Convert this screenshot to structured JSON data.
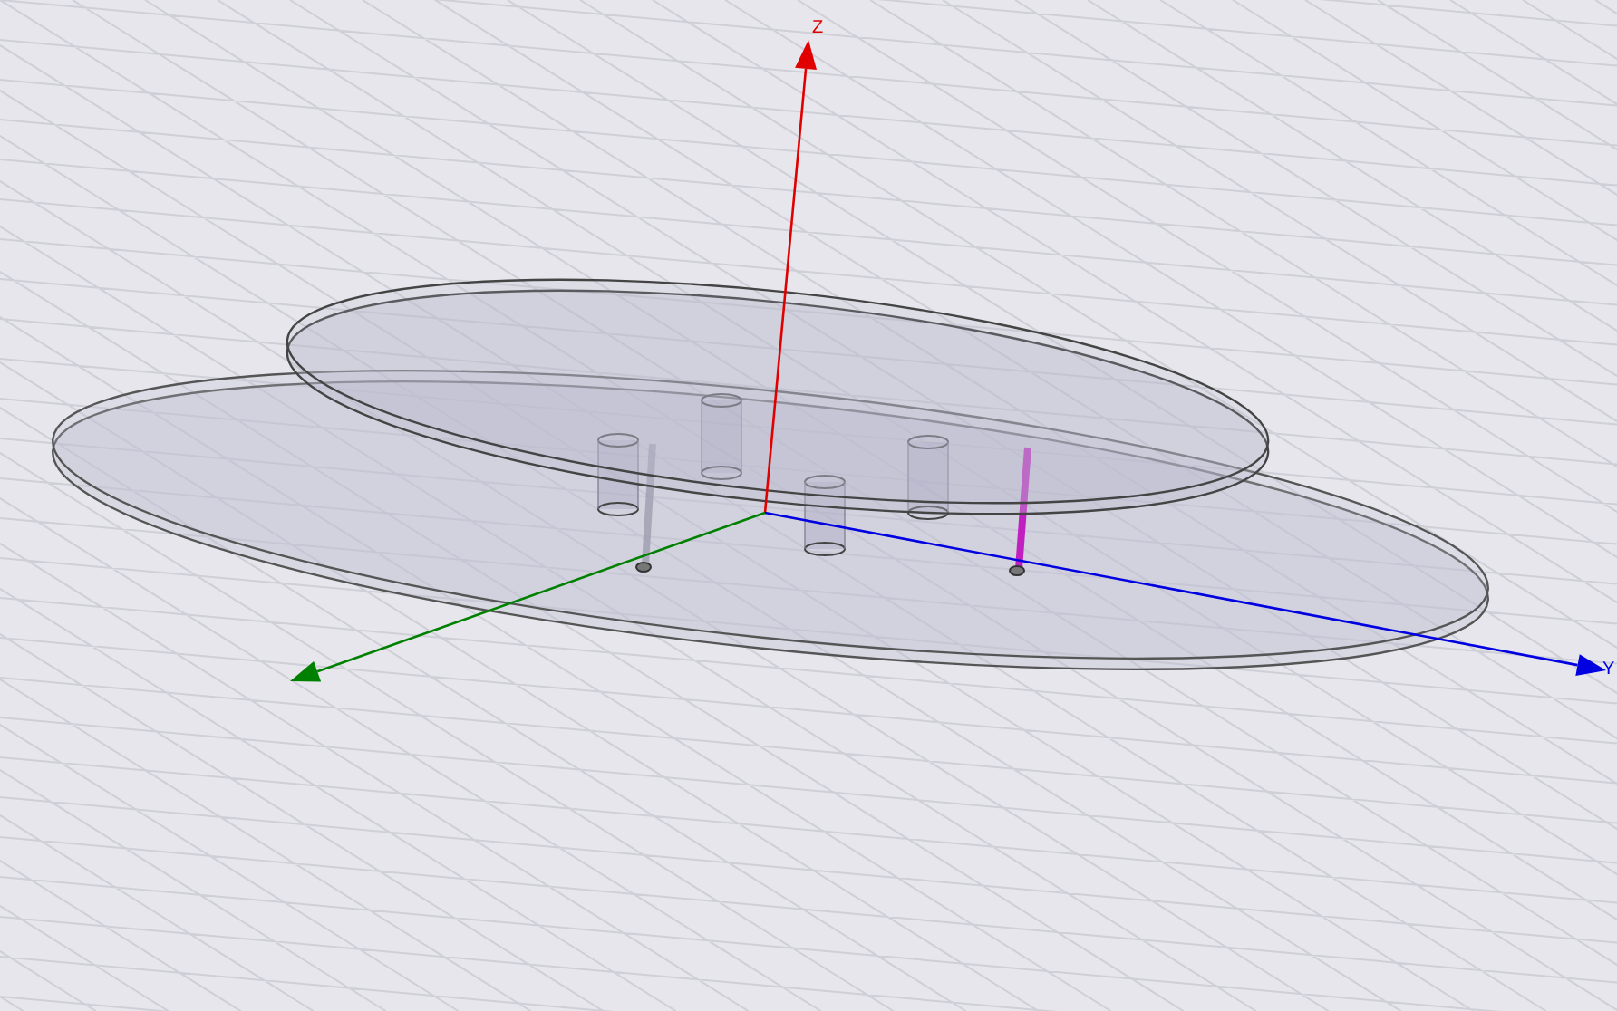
{
  "viewport": {
    "axes": [
      {
        "kind": "z",
        "label": "Z"
      },
      {
        "kind": "y",
        "label": "Y"
      },
      {
        "kind": "x"
      }
    ]
  }
}
